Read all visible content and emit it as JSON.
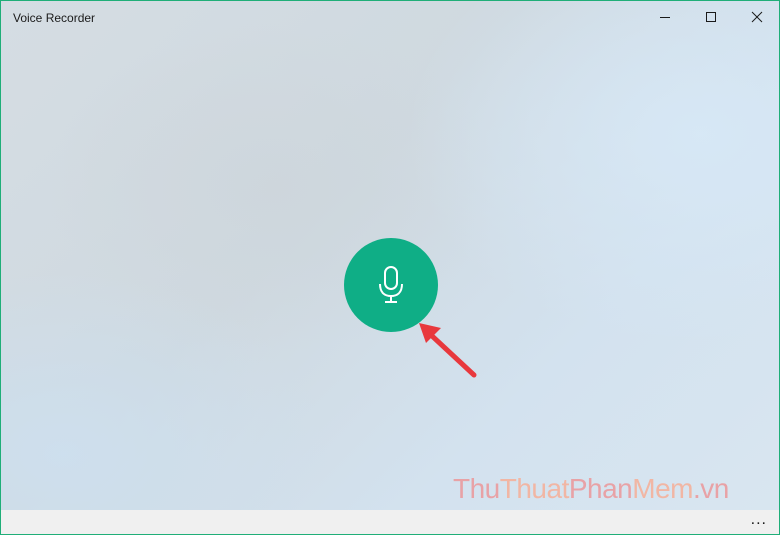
{
  "window": {
    "title": "Voice Recorder",
    "accent_color": "#0fae86",
    "border_color": "#1fae78"
  },
  "caption_buttons": {
    "minimize_icon": "minimize-icon",
    "maximize_icon": "maximize-icon",
    "close_icon": "close-icon"
  },
  "main": {
    "record_button_icon": "microphone-icon",
    "annotation": {
      "arrow_icon": "arrow-icon",
      "arrow_color": "#e8383d"
    }
  },
  "watermark": {
    "part1": "Thu",
    "part2": "Thuat",
    "part3": "Phan",
    "part4": "Mem",
    "part5": ".vn"
  },
  "commandbar": {
    "more_label": "..."
  }
}
